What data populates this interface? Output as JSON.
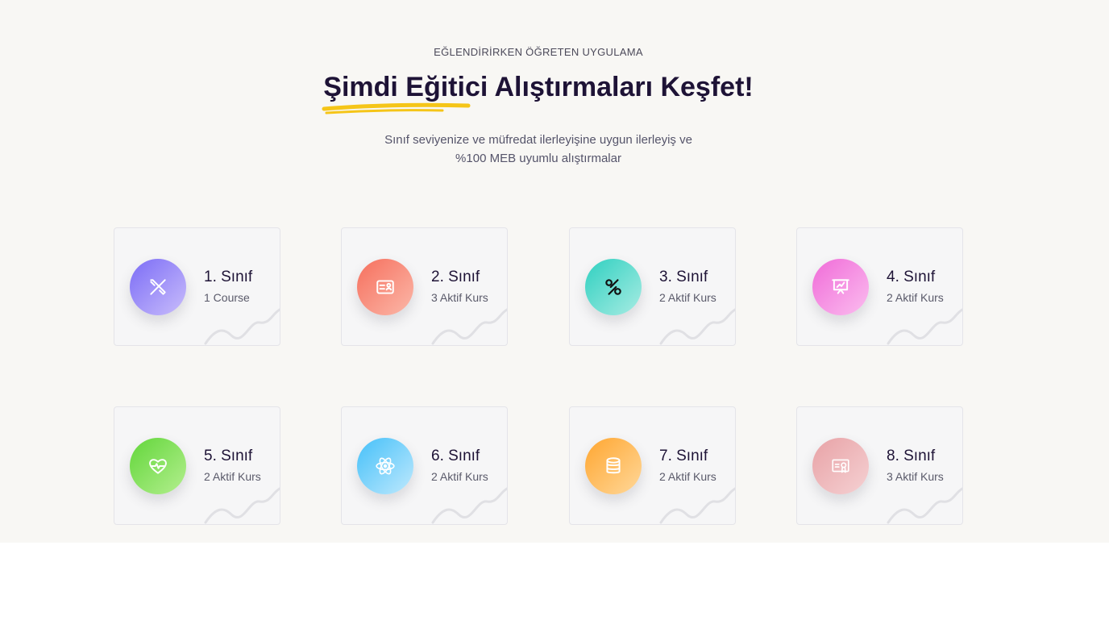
{
  "header": {
    "eyebrow": "EĞLENDİRİRKEN ÖĞRETEN UYGULAMA",
    "title_highlight": "Şimdi Eğitici",
    "title_rest": " Alıştırmaları Keşfet!",
    "highlight_color": "#f5c518",
    "subtitle_line1": "Sınıf seviyenize ve müfredat ilerleyişine uygun ilerleyiş ve",
    "subtitle_line2": "%100 MEB uyumlu alıştırmalar"
  },
  "classes": [
    {
      "title": "1. Sınıf",
      "subtitle": "1 Course",
      "icon": "pencil-ruler-icon",
      "gradient": [
        "#7b6cf6",
        "#c9bdfb"
      ]
    },
    {
      "title": "2. Sınıf",
      "subtitle": "3 Aktif Kurs",
      "icon": "id-card-icon",
      "gradient": [
        "#f66f5d",
        "#fbb8a9"
      ]
    },
    {
      "title": "3. Sınıf",
      "subtitle": "2 Aktif Kurs",
      "icon": "percent-icon",
      "gradient": [
        "#2fd0c0",
        "#a8ece3"
      ]
    },
    {
      "title": "4. Sınıf",
      "subtitle": "2 Aktif Kurs",
      "icon": "presentation-icon",
      "gradient": [
        "#f06bd8",
        "#fbbdef"
      ]
    },
    {
      "title": "5. Sınıf",
      "subtitle": "2 Aktif Kurs",
      "icon": "heart-pulse-icon",
      "gradient": [
        "#62d63a",
        "#b4ef8f"
      ]
    },
    {
      "title": "6. Sınıf",
      "subtitle": "2 Aktif Kurs",
      "icon": "atom-icon",
      "gradient": [
        "#45c0f9",
        "#bfe9fd"
      ]
    },
    {
      "title": "7. Sınıf",
      "subtitle": "2 Aktif Kurs",
      "icon": "database-icon",
      "gradient": [
        "#ffa630",
        "#ffd89a"
      ]
    },
    {
      "title": "8. Sınıf",
      "subtitle": "3 Aktif Kurs",
      "icon": "certificate-icon",
      "gradient": [
        "#e8a2a6",
        "#f5d1d3"
      ]
    }
  ]
}
